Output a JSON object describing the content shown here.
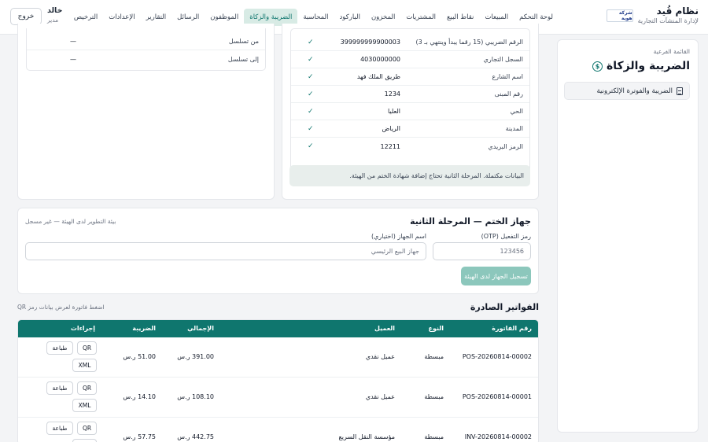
{
  "brand": {
    "logo_text": "شركة هوية",
    "name": "نظام قُيد",
    "tagline": "لإدارة المنشآت التجارية"
  },
  "nav": {
    "items": [
      {
        "label": "لوحة التحكم",
        "active": false
      },
      {
        "label": "المبيعات",
        "active": false
      },
      {
        "label": "نقاط البيع",
        "active": false
      },
      {
        "label": "المشتريات",
        "active": false
      },
      {
        "label": "المخزون",
        "active": false
      },
      {
        "label": "الباركود",
        "active": false
      },
      {
        "label": "المحاسبة",
        "active": false
      },
      {
        "label": "الضريبة والزكاة",
        "active": true
      },
      {
        "label": "الموظفون",
        "active": false
      },
      {
        "label": "الرسائل",
        "active": false
      },
      {
        "label": "التقارير",
        "active": false
      },
      {
        "label": "الإعدادات",
        "active": false
      },
      {
        "label": "الترخيص",
        "active": false
      }
    ]
  },
  "user": {
    "name": "خالد",
    "role": "مدير",
    "logout": "خروج"
  },
  "sidebar": {
    "caption": "القائمة الفرعية",
    "title": "الضريبة والزكاة",
    "items": [
      {
        "label": "الضريبة والفوترة الإلكترونية"
      }
    ]
  },
  "taxinfo": {
    "rows": [
      {
        "label": "الرقم الضريبي (15 رقما يبدأ وينتهي بـ 3)",
        "value": "399999999900003",
        "check": "✓"
      },
      {
        "label": "السجل التجاري",
        "value": "4030000000",
        "check": "✓"
      },
      {
        "label": "اسم الشارع",
        "value": "طريق الملك فهد",
        "check": "✓"
      },
      {
        "label": "رقم المبنى",
        "value": "1234",
        "check": "✓"
      },
      {
        "label": "الحي",
        "value": "العليا",
        "check": "✓"
      },
      {
        "label": "المدينة",
        "value": "الرياض",
        "check": "✓"
      },
      {
        "label": "الرمز البريدي",
        "value": "12211",
        "check": "✓"
      }
    ],
    "note": "البيانات مكتملة. المرحلة الثانية تحتاج إضافة شهادة الختم من الهيئة."
  },
  "counter": {
    "rows": [
      {
        "label": "من تسلسل",
        "value": "—"
      },
      {
        "label": "إلى تسلسل",
        "value": "—"
      }
    ]
  },
  "device": {
    "title": "جهاز الختم — المرحلة الثانية",
    "env": "بيئة التطوير لدى الهيئة — غير مسجل",
    "otp_label": "رمز التفعيل (OTP)",
    "otp_placeholder": "123456",
    "name_label": "اسم الجهاز (اختياري)",
    "name_placeholder": "جهاز البيع الرئيسي",
    "register": "تسجيل الجهاز لدى الهيئة"
  },
  "invoices": {
    "title": "الفواتير الصادرة",
    "hint": "اضغط فاتورة لعرض بيانات رمز QR",
    "headers": {
      "number": "رقم الفاتورة",
      "type": "النوع",
      "customer": "العميل",
      "total": "الإجمالي",
      "tax": "الضريبة",
      "actions": "إجراءات"
    },
    "actions": {
      "qr": "QR",
      "print": "طباعة",
      "xml": "XML"
    },
    "rows": [
      {
        "number": "POS-20260814-00002",
        "type": "مبسطة",
        "customer": "عميل نقدي",
        "total": "391.00 ر.س",
        "tax": "51.00 ر.س"
      },
      {
        "number": "POS-20260814-00001",
        "type": "مبسطة",
        "customer": "عميل نقدي",
        "total": "108.10 ر.س",
        "tax": "14.10 ر.س"
      },
      {
        "number": "INV-20260814-00002",
        "type": "مبسطة",
        "customer": "مؤسسة النقل السريع",
        "total": "442.75 ر.س",
        "tax": "57.75 ر.س"
      }
    ]
  }
}
